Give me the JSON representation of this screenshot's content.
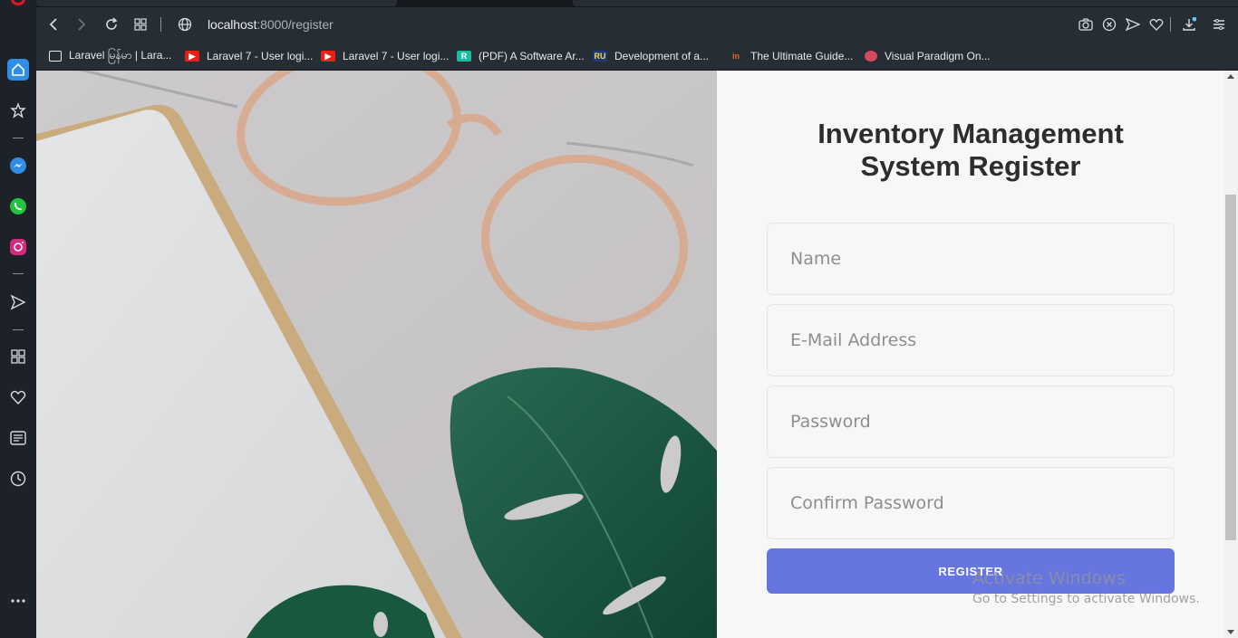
{
  "browser": {
    "url_host": "localhost",
    "url_path": ":8000/register",
    "bookmarks": [
      {
        "label": "Laravel မြန်မာ | Lara...",
        "color": "#ffffff"
      },
      {
        "label": "Laravel 7 - User logi...",
        "color": "#e62117"
      },
      {
        "label": "Laravel 7 - User logi...",
        "color": "#e62117"
      },
      {
        "label": "(PDF) A Software Ar...",
        "color": "#1fb8a0"
      },
      {
        "label": "Development of a...",
        "color": "#1b3a7a"
      },
      {
        "label": "The Ultimate Guide...",
        "color": "#f26522"
      },
      {
        "label": "Visual Paradigm On...",
        "color": "#d64a5d"
      }
    ]
  },
  "page": {
    "title_line1": "Inventory Management",
    "title_line2": "System Register",
    "fields": {
      "name_placeholder": "Name",
      "email_placeholder": "E-Mail Address",
      "password_placeholder": "Password",
      "confirm_placeholder": "Confirm Password"
    },
    "register_label": "REGISTER",
    "accent": "#6675df"
  },
  "watermark": {
    "line1": "Activate Windows",
    "line2": "Go to Settings to activate Windows."
  }
}
